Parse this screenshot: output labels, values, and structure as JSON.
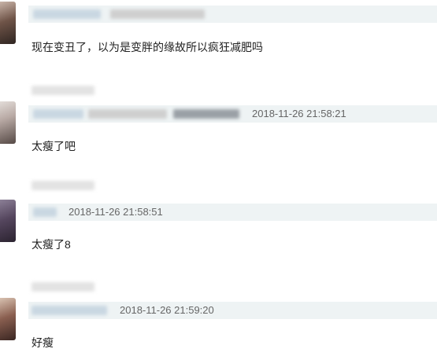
{
  "comments": [
    {
      "timestamp": "",
      "text": "现在变丑了，以为是变胖的缘故所以疯狂减肥吗"
    },
    {
      "timestamp": "2018-11-26 21:58:21",
      "text": "太瘦了吧"
    },
    {
      "timestamp": "2018-11-26 21:58:51",
      "text": "太瘦了8"
    },
    {
      "timestamp": "2018-11-26 21:59:20",
      "text": "好瘦"
    }
  ]
}
